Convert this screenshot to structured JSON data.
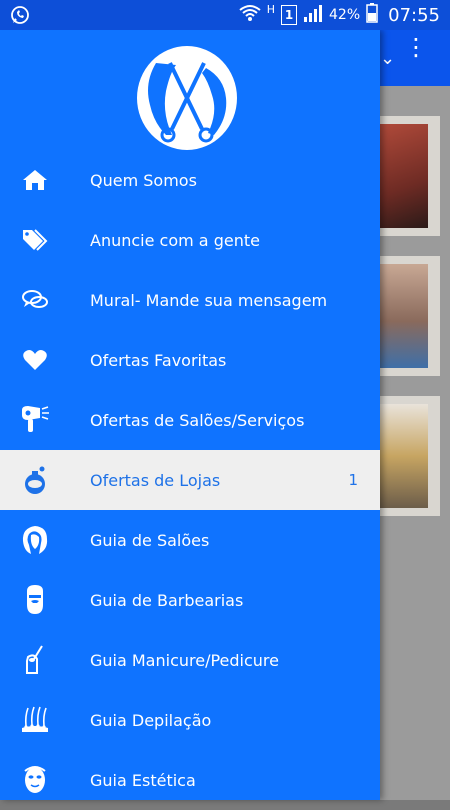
{
  "status_bar": {
    "signal_h": "H",
    "sim_number": "1",
    "battery_percent": "42%",
    "time": "07:55"
  },
  "drawer": {
    "items": [
      {
        "label": "Quem Somos",
        "icon": "home-icon"
      },
      {
        "label": "Anuncie com a gente",
        "icon": "tags-icon"
      },
      {
        "label": "Mural- Mande sua mensagem",
        "icon": "chat-bubbles-icon"
      },
      {
        "label": "Ofertas Favoritas",
        "icon": "heart-icon"
      },
      {
        "label": "Ofertas de Salões/Serviços",
        "icon": "hair-dryer-icon"
      },
      {
        "label": "Ofertas de Lojas",
        "icon": "perfume-icon",
        "badge": "1",
        "active": true
      },
      {
        "label": "Guia de Salões",
        "icon": "woman-hair-icon"
      },
      {
        "label": "Guia de Barbearias",
        "icon": "bearded-man-icon"
      },
      {
        "label": "Guia Manicure/Pedicure",
        "icon": "nail-polish-icon"
      },
      {
        "label": "Guia Depilação",
        "icon": "hair-removal-icon"
      },
      {
        "label": "Guia Estética",
        "icon": "face-mask-icon"
      }
    ]
  },
  "colors": {
    "drawer_bg": "#0f73ff",
    "status_bar": "#0d4fd8",
    "active_bg": "#efefef",
    "active_text": "#1e72e8"
  }
}
